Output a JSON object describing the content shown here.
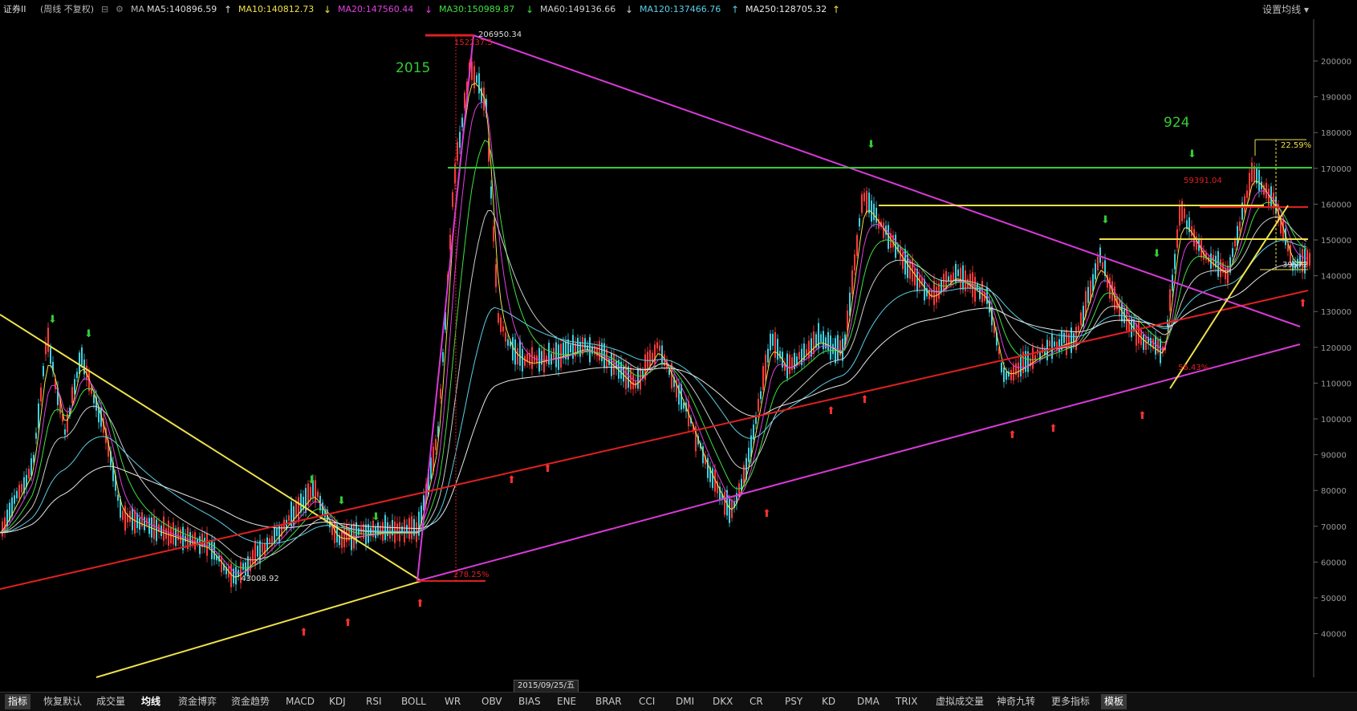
{
  "header": {
    "title": "证券II",
    "mode": "(周线 不复权)",
    "ma_label": "MA",
    "mas": [
      {
        "label": "MA5:140896.59",
        "color": "#dddddd",
        "arrow": "↑",
        "arrow_color": "#dddddd"
      },
      {
        "label": "MA10:140812.73",
        "color": "#f0e24a",
        "arrow": "↓",
        "arrow_color": "#f0e24a"
      },
      {
        "label": "MA20:147560.44",
        "color": "#e040e0",
        "arrow": "↓",
        "arrow_color": "#e040e0"
      },
      {
        "label": "MA30:150989.87",
        "color": "#40e040",
        "arrow": "↓",
        "arrow_color": "#40e040"
      },
      {
        "label": "MA60:149136.66",
        "color": "#cccccc",
        "arrow": "↓",
        "arrow_color": "#cccccc"
      },
      {
        "label": "MA120:137466.76",
        "color": "#5ad0e8",
        "arrow": "↑",
        "arrow_color": "#5ad0e8"
      },
      {
        "label": "MA250:128705.32",
        "color": "#e8e8e8",
        "arrow": "↑",
        "arrow_color": "#f0e24a"
      }
    ],
    "settings_label": "设置均线"
  },
  "axis": {
    "ticks": [
      "200000",
      "190000",
      "180000",
      "170000",
      "160000",
      "150000",
      "140000",
      "130000",
      "120000",
      "110000",
      "100000",
      "90000",
      "80000",
      "70000",
      "60000",
      "50000",
      "40000"
    ]
  },
  "annotations": {
    "year_2015": "2015",
    "year_924": "924",
    "peak_price": "206950.34",
    "peak_pct": "152237.5",
    "low_price": "43008.92",
    "pct_278": "278.25%",
    "price_59391": "59391.04",
    "pct_2259": "22.59%",
    "price_39572": "39572",
    "pct_5643": "56.43%"
  },
  "date_badge": "2015/09/25/五",
  "tabs": [
    "指标",
    "恢复默认",
    "成交量",
    "均线",
    "资金博弈",
    "资金趋势",
    "MACD",
    "KDJ",
    "RSI",
    "BOLL",
    "WR",
    "OBV",
    "BIAS",
    "ENE",
    "BRAR",
    "CCI",
    "DMI",
    "DKX",
    "CR",
    "PSY",
    "KD",
    "DMA",
    "TRIX",
    "虚拟成交量",
    "神奇九转",
    "更多指标",
    "模板"
  ],
  "colors": {
    "up": "#ff3b3b",
    "down": "#3fd0e0",
    "green_line": "#33cc33",
    "red_line": "#e02020",
    "yellow_line": "#f0e24a",
    "magenta_line": "#d83ad8"
  }
}
